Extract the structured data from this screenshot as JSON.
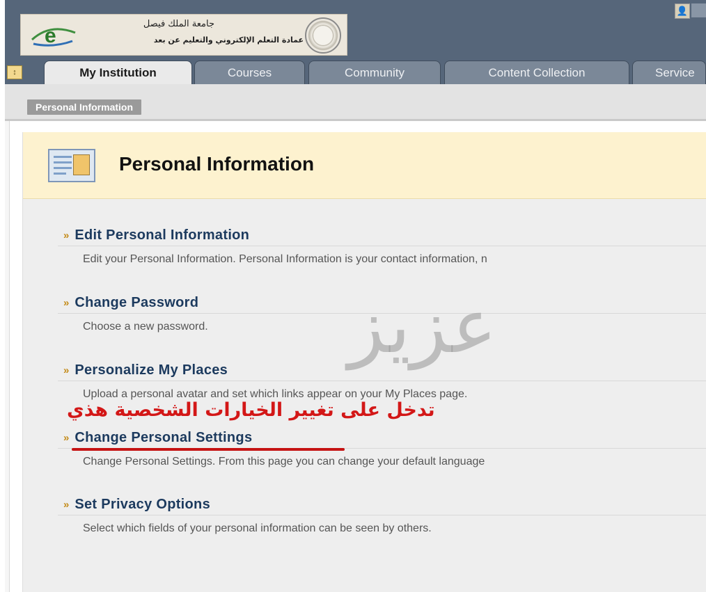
{
  "header": {
    "logo_line1": "جامعة الملك فيصل",
    "logo_line2": "عمادة التعلم الإلكتروني والتعليم عن بعد"
  },
  "tabs": [
    {
      "label": "My Institution",
      "active": true
    },
    {
      "label": "Courses",
      "active": false
    },
    {
      "label": "Community",
      "active": false
    },
    {
      "label": "Content Collection",
      "active": false
    },
    {
      "label": "Service",
      "active": false
    }
  ],
  "breadcrumb": "Personal Information",
  "page": {
    "title": "Personal Information",
    "items": [
      {
        "link": "Edit Personal Information",
        "description": "Edit your Personal Information. Personal Information is your contact information, n"
      },
      {
        "link": "Change Password",
        "description": "Choose a new password."
      },
      {
        "link": "Personalize My Places",
        "description": "Upload a personal avatar and set which links appear on your My Places page."
      },
      {
        "link": "Change Personal Settings",
        "description": "Change Personal Settings. From this page you can change your default language"
      },
      {
        "link": "Set Privacy Options",
        "description": "Select which fields of your personal information can be seen by others."
      }
    ]
  },
  "overlay": {
    "watermark": "عزيز",
    "annotation": "تدخل على تغيير الخيارات الشخصية هذي",
    "annotation_color": "#d31717"
  },
  "icons": {
    "chevron": "»",
    "collapse": "↕",
    "user": "👤"
  }
}
